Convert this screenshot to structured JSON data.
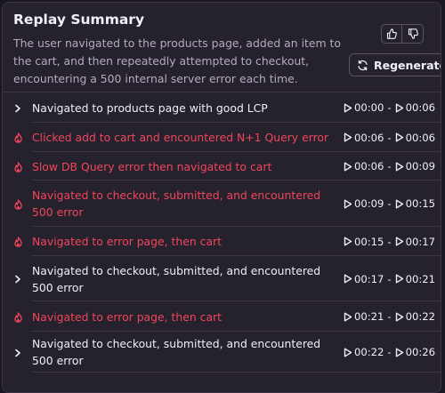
{
  "header": {
    "title": "Replay Summary",
    "summary": "The user navigated to the products page, added an item to the cart, and then repeatedly attempted to checkout, encountering a 500 internal server error each time.",
    "regenerate_label": "Regenerate",
    "thumbs_up_icon": "thumbs-up-icon",
    "thumbs_down_icon": "thumbs-down-icon",
    "regenerate_icon": "refresh-icon"
  },
  "colors": {
    "error": "#f1465b",
    "text": "#f2eff7",
    "muted": "#b3acbf",
    "panel": "#25212d",
    "border": "#3b3545"
  },
  "rows": [
    {
      "kind": "chevron",
      "label": "Navigated to products page with good LCP",
      "start": "00:00",
      "end": "00:06"
    },
    {
      "kind": "error",
      "label": "Clicked add to cart and encountered N+1 Query error",
      "start": "00:06",
      "end": "00:06"
    },
    {
      "kind": "error",
      "label": "Slow DB Query error then navigated to cart",
      "start": "00:06",
      "end": "00:09"
    },
    {
      "kind": "error",
      "label": "Navigated to checkout, submitted, and encountered 500 error",
      "start": "00:09",
      "end": "00:15"
    },
    {
      "kind": "error",
      "label": "Navigated to error page, then cart",
      "start": "00:15",
      "end": "00:17"
    },
    {
      "kind": "chevron",
      "label": "Navigated to checkout, submitted, and encountered 500 error",
      "start": "00:17",
      "end": "00:21"
    },
    {
      "kind": "error",
      "label": "Navigated to error page, then cart",
      "start": "00:21",
      "end": "00:22"
    },
    {
      "kind": "chevron",
      "label": "Navigated to checkout, submitted, and encountered 500 error",
      "start": "00:22",
      "end": "00:26"
    }
  ]
}
